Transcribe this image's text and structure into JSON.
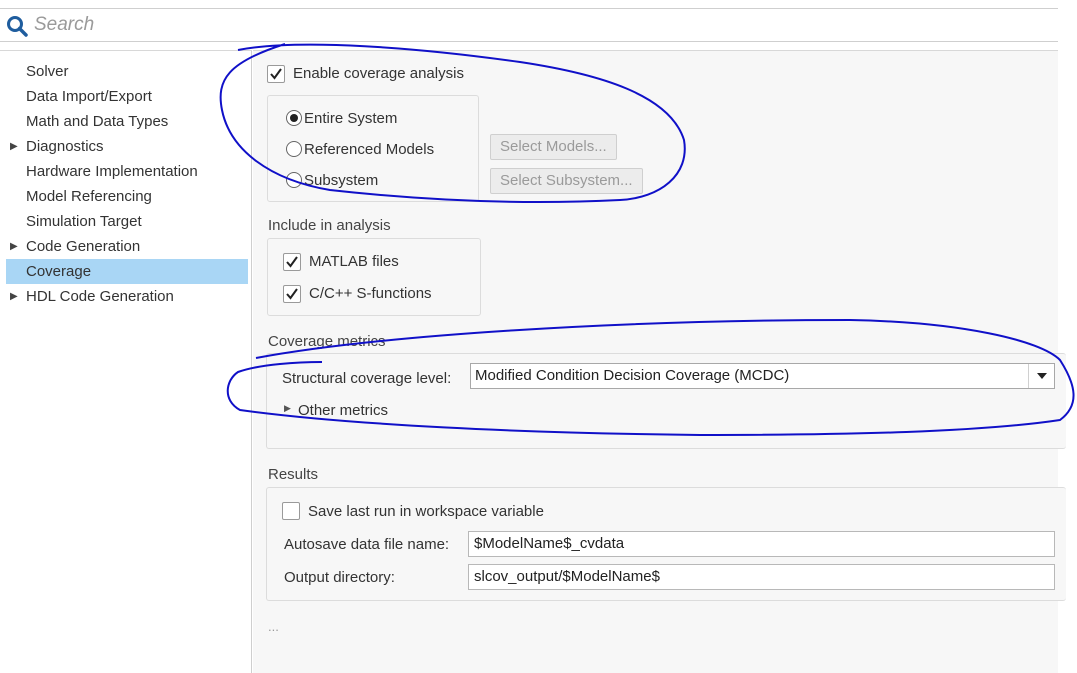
{
  "search": {
    "placeholder": "Search",
    "icon": "magnifier"
  },
  "sidebar": {
    "items": [
      {
        "label": "Solver",
        "expandable": false,
        "selected": false
      },
      {
        "label": "Data Import/Export",
        "expandable": false,
        "selected": false
      },
      {
        "label": "Math and Data Types",
        "expandable": false,
        "selected": false
      },
      {
        "label": "Diagnostics",
        "expandable": true,
        "selected": false
      },
      {
        "label": "Hardware Implementation",
        "expandable": false,
        "selected": false
      },
      {
        "label": "Model Referencing",
        "expandable": false,
        "selected": false
      },
      {
        "label": "Simulation Target",
        "expandable": false,
        "selected": false
      },
      {
        "label": "Code Generation",
        "expandable": true,
        "selected": false
      },
      {
        "label": "Coverage",
        "expandable": false,
        "selected": true
      },
      {
        "label": "HDL Code Generation",
        "expandable": true,
        "selected": false
      }
    ]
  },
  "coverage": {
    "enable_label": "Enable coverage analysis",
    "enable_checked": true,
    "scope": {
      "options": [
        "Entire System",
        "Referenced Models",
        "Subsystem"
      ],
      "selected": "Entire System",
      "select_models_button": "Select Models...",
      "select_subsystem_button": "Select Subsystem..."
    },
    "include": {
      "title": "Include in analysis",
      "matlab_files_label": "MATLAB files",
      "matlab_files_checked": true,
      "sfunctions_label": "C/C++ S-functions",
      "sfunctions_checked": true
    },
    "metrics": {
      "title": "Coverage metrics",
      "structural_label": "Structural coverage level:",
      "structural_value": "Modified Condition Decision Coverage (MCDC)",
      "other_metrics_label": "Other metrics"
    },
    "results": {
      "title": "Results",
      "save_last_run_label": "Save last run in workspace variable",
      "save_last_run_checked": false,
      "autosave_label": "Autosave data file name:",
      "autosave_value": "$ModelName$_cvdata",
      "output_dir_label": "Output directory:",
      "output_dir_value": "slcov_output/$ModelName$"
    },
    "more_indicator": "..."
  },
  "colors": {
    "selected_bg": "#a9d6f5",
    "search_icon": "#1f5d9e",
    "annotation_ink": "#1010c8",
    "panel_bg": "#f7f7f7"
  }
}
